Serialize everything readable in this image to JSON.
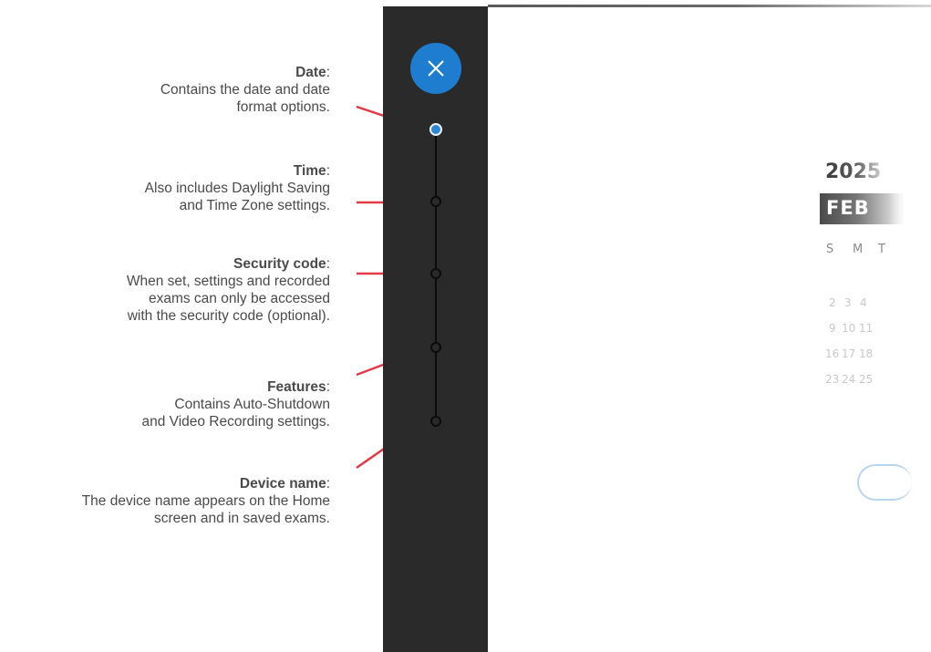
{
  "annotations": [
    {
      "title": "Date",
      "lines": [
        "Contains the date and date",
        "format options."
      ]
    },
    {
      "title": "Time",
      "lines": [
        "Also includes Daylight Saving",
        "and Time Zone settings."
      ]
    },
    {
      "title": "Security code",
      "lines": [
        "When set, settings and recorded",
        "exams can only be accessed",
        "with the security code (optional)."
      ]
    },
    {
      "title": "Features",
      "lines": [
        "Contains Auto-Shutdown",
        "and Video Recording settings."
      ]
    },
    {
      "title": "Device name",
      "lines": [
        "The device name appears on the Home",
        "screen and in saved exams."
      ]
    }
  ],
  "sidebar": {
    "close_icon": "close-icon",
    "steps": [
      "Date",
      "Time",
      "Security code",
      "Features",
      "Device name"
    ],
    "active_step": 0,
    "accent_color": "#1f7dd0"
  },
  "calendar": {
    "year": "2025",
    "month": "FEB",
    "weekdays": [
      "S",
      "M",
      "T"
    ],
    "rows": [
      [
        "2",
        "3",
        "4"
      ],
      [
        "9",
        "10",
        "11"
      ],
      [
        "16",
        "17",
        "18"
      ],
      [
        "23",
        "24",
        "25"
      ]
    ]
  },
  "colors": {
    "pointer": "#e23a46",
    "sidebar": "#2a2a2a"
  }
}
